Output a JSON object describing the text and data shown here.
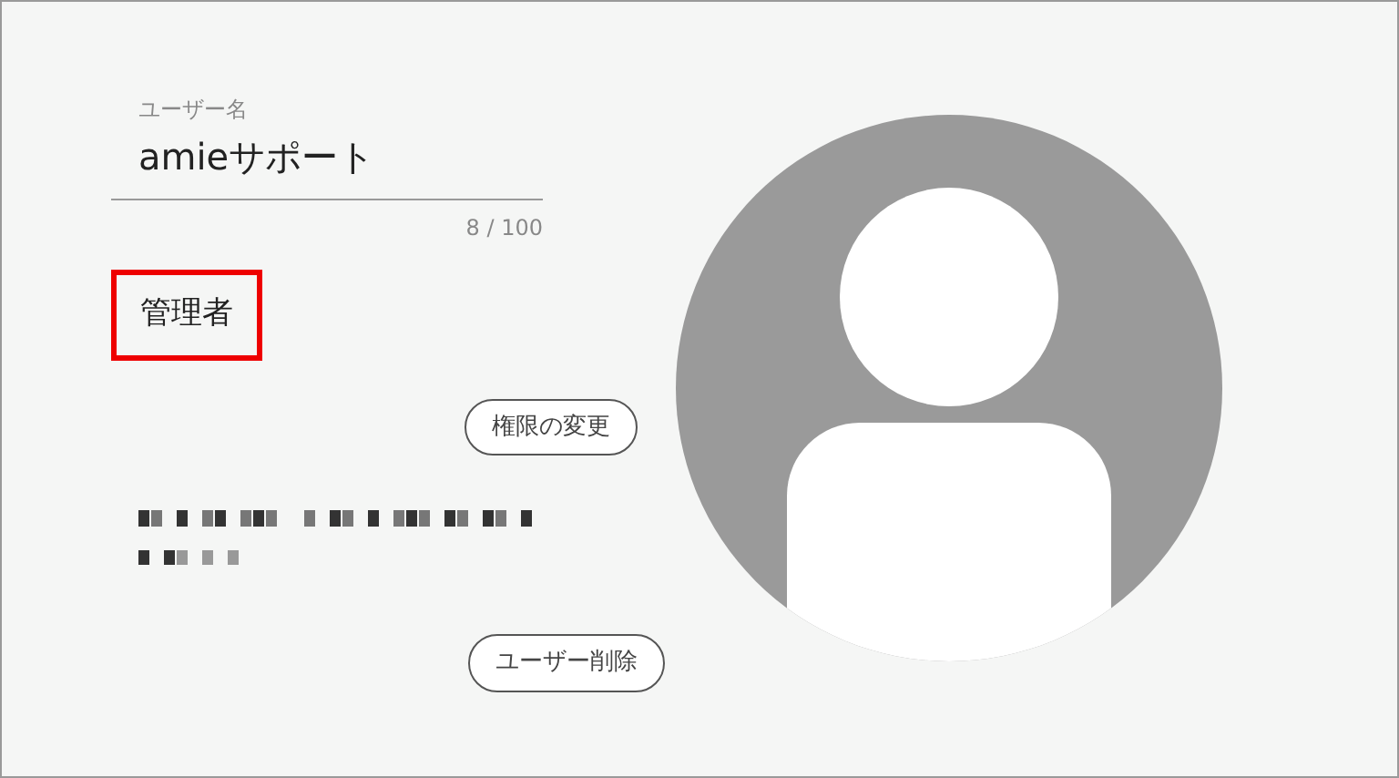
{
  "username_field": {
    "label": "ユーザー名",
    "value": "amieサポート",
    "counter": "8 / 100"
  },
  "role": {
    "text": "管理者",
    "highlighted": true
  },
  "buttons": [
    {
      "label": "権限の変更"
    },
    {
      "label": "ユーザー削除"
    }
  ]
}
